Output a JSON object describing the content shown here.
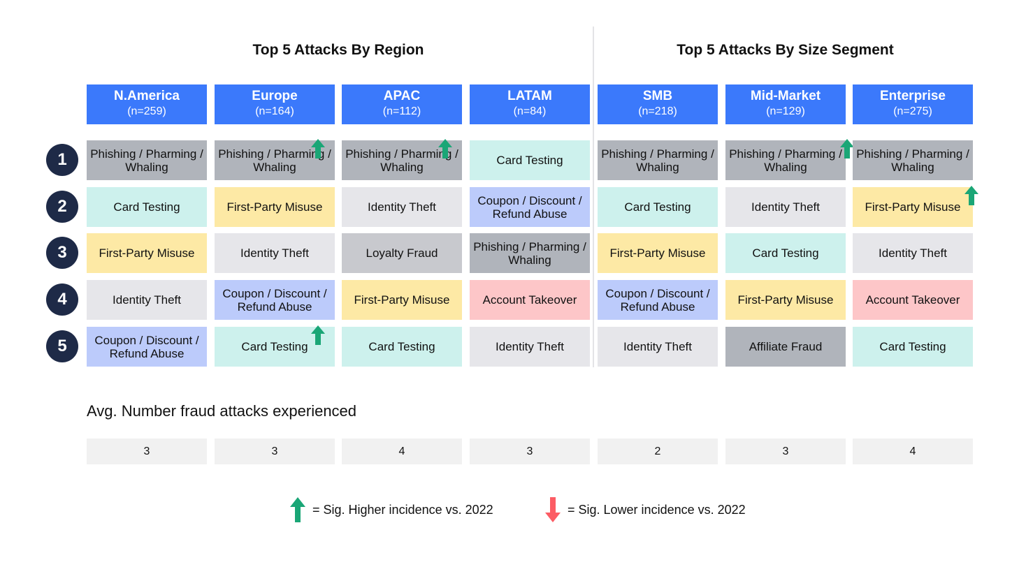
{
  "titles": {
    "region": "Top 5 Attacks By Region",
    "size": "Top 5 Attacks By Size Segment"
  },
  "columns": [
    {
      "name": "N.America",
      "n": "(n=259)"
    },
    {
      "name": "Europe",
      "n": "(n=164)"
    },
    {
      "name": "APAC",
      "n": "(n=112)"
    },
    {
      "name": "LATAM",
      "n": "(n=84)"
    },
    {
      "name": "SMB",
      "n": "(n=218)"
    },
    {
      "name": "Mid-Market",
      "n": "(n=129)"
    },
    {
      "name": "Enterprise",
      "n": "(n=275)"
    }
  ],
  "ranks": [
    "1",
    "2",
    "3",
    "4",
    "5"
  ],
  "grid": [
    [
      {
        "label": "Phishing / Pharming / Whaling",
        "type": "phishing",
        "trend": null
      },
      {
        "label": "Card Testing",
        "type": "card",
        "trend": null
      },
      {
        "label": "First-Party Misuse",
        "type": "first",
        "trend": null
      },
      {
        "label": "Identity Theft",
        "type": "identity",
        "trend": null
      },
      {
        "label": "Coupon / Discount / Refund Abuse",
        "type": "coupon",
        "trend": null
      }
    ],
    [
      {
        "label": "Phishing / Pharming / Whaling",
        "type": "phishing",
        "trend": "up"
      },
      {
        "label": "First-Party Misuse",
        "type": "first",
        "trend": null
      },
      {
        "label": "Identity Theft",
        "type": "identity",
        "trend": null
      },
      {
        "label": "Coupon / Discount / Refund Abuse",
        "type": "coupon",
        "trend": null
      },
      {
        "label": "Card Testing",
        "type": "card",
        "trend": "up"
      }
    ],
    [
      {
        "label": "Phishing / Pharming / Whaling",
        "type": "phishing",
        "trend": "up"
      },
      {
        "label": "Identity Theft",
        "type": "identity",
        "trend": null
      },
      {
        "label": "Loyalty Fraud",
        "type": "loyalty",
        "trend": null
      },
      {
        "label": "First-Party Misuse",
        "type": "first",
        "trend": null
      },
      {
        "label": "Card Testing",
        "type": "card",
        "trend": null
      }
    ],
    [
      {
        "label": "Card Testing",
        "type": "card",
        "trend": null
      },
      {
        "label": "Coupon / Discount / Refund Abuse",
        "type": "coupon",
        "trend": null
      },
      {
        "label": "Phishing / Pharming / Whaling",
        "type": "phishing",
        "trend": null
      },
      {
        "label": "Account Takeover",
        "type": "ato",
        "trend": null
      },
      {
        "label": "Identity Theft",
        "type": "identity",
        "trend": null
      }
    ],
    [
      {
        "label": "Phishing / Pharming / Whaling",
        "type": "phishing",
        "trend": null
      },
      {
        "label": "Card Testing",
        "type": "card",
        "trend": null
      },
      {
        "label": "First-Party Misuse",
        "type": "first",
        "trend": null
      },
      {
        "label": "Coupon / Discount / Refund Abuse",
        "type": "coupon",
        "trend": null
      },
      {
        "label": "Identity Theft",
        "type": "identity",
        "trend": null
      }
    ],
    [
      {
        "label": "Phishing / Pharming / Whaling",
        "type": "phishing",
        "trend": "up"
      },
      {
        "label": "Identity Theft",
        "type": "identity",
        "trend": null
      },
      {
        "label": "Card Testing",
        "type": "card",
        "trend": null
      },
      {
        "label": "First-Party Misuse",
        "type": "first",
        "trend": null
      },
      {
        "label": "Affiliate Fraud",
        "type": "affiliate",
        "trend": null
      }
    ],
    [
      {
        "label": "Phishing / Pharming / Whaling",
        "type": "phishing",
        "trend": null
      },
      {
        "label": "First-Party Misuse",
        "type": "first",
        "trend": "up"
      },
      {
        "label": "Identity Theft",
        "type": "identity",
        "trend": null
      },
      {
        "label": "Account Takeover",
        "type": "ato",
        "trend": null
      },
      {
        "label": "Card Testing",
        "type": "card",
        "trend": null
      }
    ]
  ],
  "avg": {
    "label": "Avg. Number fraud attacks experienced",
    "values": [
      "3",
      "3",
      "4",
      "3",
      "2",
      "3",
      "4"
    ]
  },
  "legend": {
    "up": "= Sig. Higher incidence vs. 2022",
    "down": "= Sig. Lower incidence vs. 2022"
  },
  "colors": {
    "header": "#3b79fb",
    "badge": "#1e2a47",
    "up_arrow": "#1aa676",
    "down_arrow": "#fc5c64"
  }
}
